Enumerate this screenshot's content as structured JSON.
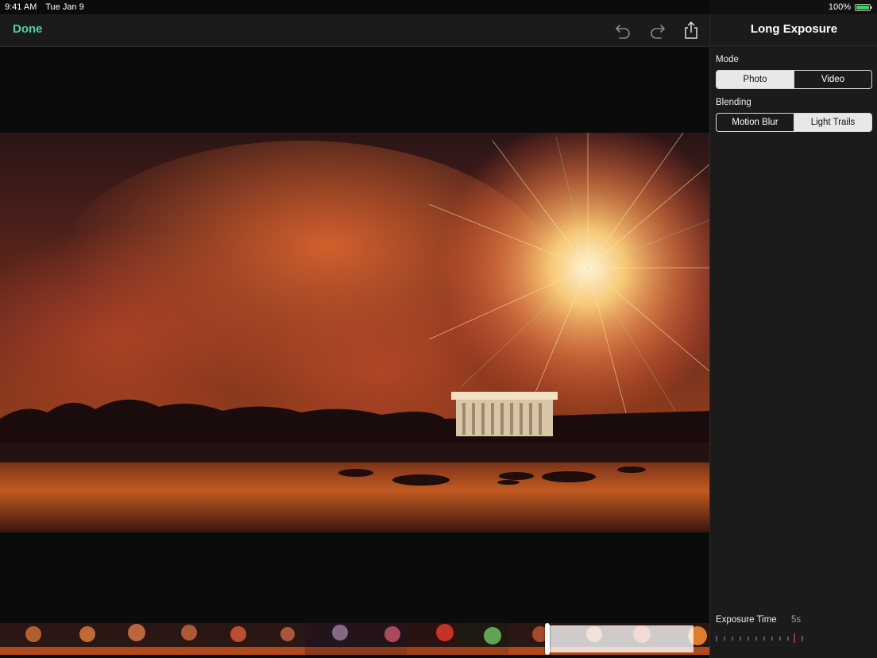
{
  "status": {
    "time": "9:41 AM",
    "date": "Tue Jan 9",
    "battery": "100%"
  },
  "toolbar": {
    "done_label": "Done"
  },
  "sidebar": {
    "title": "Long Exposure",
    "mode": {
      "label": "Mode",
      "options": [
        "Photo",
        "Video"
      ],
      "selected": "Photo"
    },
    "blending": {
      "label": "Blending",
      "options": [
        "Motion Blur",
        "Light Trails"
      ],
      "selected": "Light Trails"
    },
    "exposure": {
      "label": "Exposure Time",
      "value": "5s"
    }
  },
  "icons": {
    "undo": "undo-icon",
    "redo": "redo-icon",
    "share": "share-icon"
  },
  "colors": {
    "accent": "#4fd1a0",
    "battery": "#3bd15a",
    "exposure_marker": "#d6334f"
  }
}
